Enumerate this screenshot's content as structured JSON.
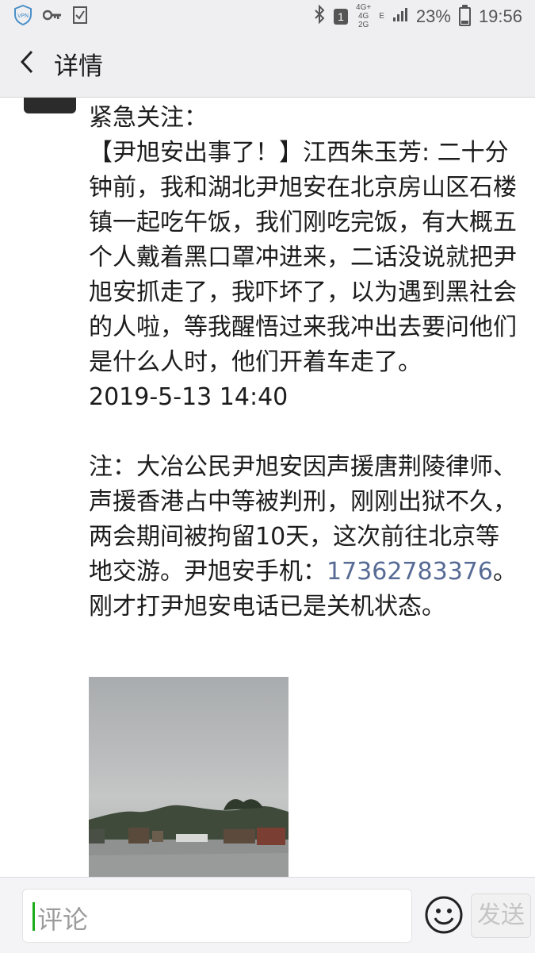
{
  "status_bar": {
    "badge": "1",
    "net_top": "4G+",
    "net_mid": "4G",
    "net_bottom": "2G",
    "net_e": "E",
    "battery_percent": "23%",
    "time": "19:56",
    "icons": [
      "shield-icon",
      "key-icon",
      "checkbox-icon",
      "bluetooth-icon",
      "signal-icon",
      "battery-icon"
    ]
  },
  "header": {
    "back_icon": "chevron-left-icon",
    "title": "详情"
  },
  "post": {
    "lines": [
      "紧急关注：",
      "【尹旭安出事了！】江西朱玉芳: 二十分钟前，我和湖北尹旭安在北京房山区石楼镇一起吃午饭，我们刚吃完饭，有大概五个人戴着黑口罩冲进来，二话没说就把尹旭安抓走了，我吓坏了，以为遇到黑社会的人啦，等我醒悟过来我冲出去要问他们是什么人时，他们开着车走了。",
      "2019-5-13 14:40",
      "",
      "注：大冶公民尹旭安因声援唐荆陵律师、声援香港占中等被判刑，刚刚出狱不久，两会期间被拘留10天，这次前往北京等地交游。尹旭安手机："
    ],
    "phone": "17362783376",
    "after_phone": "。刚才打尹旭安电话已是关机状态。",
    "link_color": "#576b95"
  },
  "comment_bar": {
    "placeholder": "评论",
    "emoji_icon": "smiley-icon",
    "send_label": "发送"
  }
}
